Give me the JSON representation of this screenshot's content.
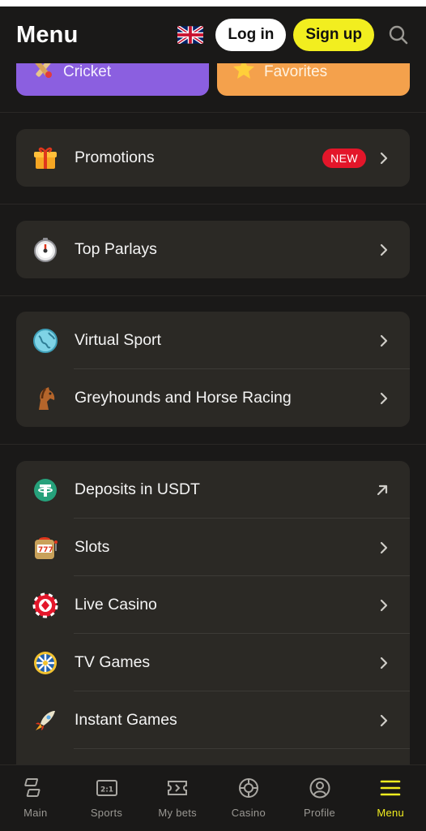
{
  "header": {
    "title": "Menu",
    "login_label": "Log in",
    "signup_label": "Sign up",
    "flag_icon": "uk-flag-icon",
    "search_icon": "search-icon"
  },
  "tiles": [
    {
      "label": "Cricket",
      "icon": "cricket-icon",
      "color": "#8b5fe0"
    },
    {
      "label": "Favorites",
      "icon": "star-icon",
      "color": "#f4a14c"
    }
  ],
  "sections": [
    {
      "items": [
        {
          "label": "Promotions",
          "icon": "gift-icon",
          "badge": "NEW",
          "action": "chevron"
        }
      ]
    },
    {
      "items": [
        {
          "label": "Top Parlays",
          "icon": "stopwatch-icon",
          "action": "chevron"
        }
      ]
    },
    {
      "items": [
        {
          "label": "Virtual Sport",
          "icon": "globe-icon",
          "action": "chevron"
        },
        {
          "label": "Greyhounds and Horse Racing",
          "icon": "horse-icon",
          "action": "chevron"
        }
      ]
    },
    {
      "items": [
        {
          "label": "Deposits in USDT",
          "icon": "tether-icon",
          "action": "external"
        },
        {
          "label": "Slots",
          "icon": "slot-machine-icon",
          "action": "chevron"
        },
        {
          "label": "Live Casino",
          "icon": "casino-chip-icon",
          "action": "chevron"
        },
        {
          "label": "TV Games",
          "icon": "wheel-icon",
          "action": "chevron"
        },
        {
          "label": "Instant Games",
          "icon": "rocket-icon",
          "action": "chevron"
        }
      ]
    }
  ],
  "bottom_nav": [
    {
      "label": "Main",
      "icon": "main-icon",
      "active": false
    },
    {
      "label": "Sports",
      "icon": "scoreboard-icon",
      "active": false
    },
    {
      "label": "My bets",
      "icon": "ticket-icon",
      "active": false
    },
    {
      "label": "Casino",
      "icon": "casino-icon",
      "active": false
    },
    {
      "label": "Profile",
      "icon": "profile-icon",
      "active": false
    },
    {
      "label": "Menu",
      "icon": "menu-icon",
      "active": true
    }
  ],
  "colors": {
    "background": "#1a1918",
    "card": "#2b2925",
    "accent": "#f2ee1f",
    "badge": "#e3162a"
  }
}
